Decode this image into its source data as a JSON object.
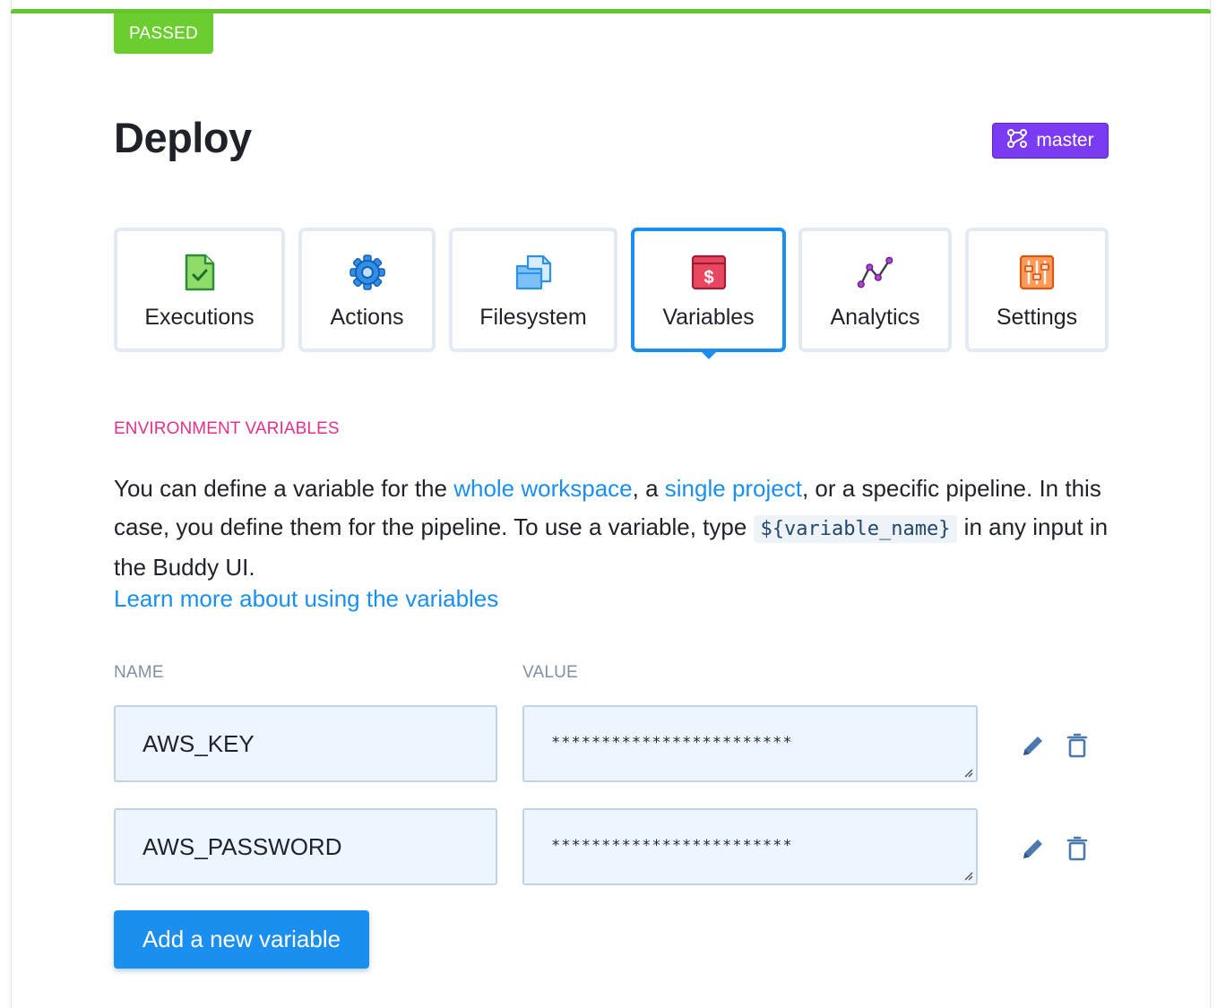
{
  "status": {
    "label": "PASSED",
    "color": "#6bcd2f"
  },
  "pipeline": {
    "title": "Deploy"
  },
  "branch": {
    "label": "master",
    "icon": "git-branch-icon",
    "color": "#7a3bf2"
  },
  "tabs": [
    {
      "label": "Executions",
      "icon": "executions-file-check-icon",
      "active": false
    },
    {
      "label": "Actions",
      "icon": "actions-gear-icon",
      "active": false
    },
    {
      "label": "Filesystem",
      "icon": "filesystem-files-icon",
      "active": false
    },
    {
      "label": "Variables",
      "icon": "variables-dollar-icon",
      "active": true
    },
    {
      "label": "Analytics",
      "icon": "analytics-line-chart-icon",
      "active": false
    },
    {
      "label": "Settings",
      "icon": "settings-sliders-icon",
      "active": false
    }
  ],
  "section": {
    "title": "ENVIRONMENT VARIABLES"
  },
  "description": {
    "part1": "You can define a variable for the ",
    "link_workspace": "whole workspace",
    "part2": ", a ",
    "link_project": "single project",
    "part3": ", or a specific pipeline. In this case, you define them for the pipeline. To use a variable, type ",
    "code": "${variable_name}",
    "part4": " in any input in the Buddy UI.",
    "learn_more": "Learn more about using the variables"
  },
  "table": {
    "name_header": "NAME",
    "value_header": "VALUE",
    "rows": [
      {
        "name": "AWS_KEY",
        "value": "************************"
      },
      {
        "name": "AWS_PASSWORD",
        "value": "************************"
      }
    ]
  },
  "add_button": {
    "label": "Add a new variable"
  },
  "colors": {
    "accent": "#1a8ff0",
    "section_label": "#e5308c",
    "passed": "#6bcd2f",
    "branch": "#7a3bf2"
  }
}
